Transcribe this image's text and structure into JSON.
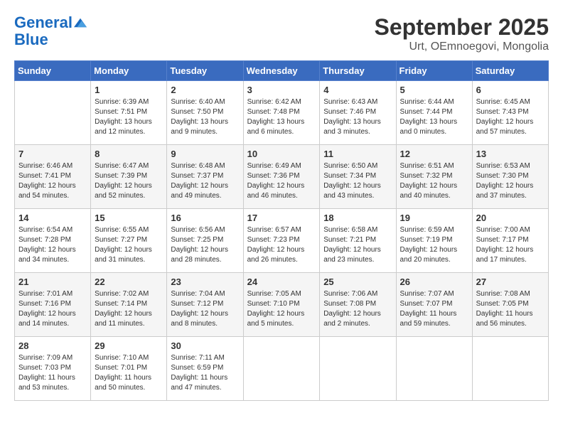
{
  "header": {
    "logo_line1": "General",
    "logo_line2": "Blue",
    "month": "September 2025",
    "location": "Urt, OEmnoegovi, Mongolia"
  },
  "weekdays": [
    "Sunday",
    "Monday",
    "Tuesday",
    "Wednesday",
    "Thursday",
    "Friday",
    "Saturday"
  ],
  "weeks": [
    [
      {
        "day": "",
        "sunrise": "",
        "sunset": "",
        "daylight": ""
      },
      {
        "day": "1",
        "sunrise": "Sunrise: 6:39 AM",
        "sunset": "Sunset: 7:51 PM",
        "daylight": "Daylight: 13 hours and 12 minutes."
      },
      {
        "day": "2",
        "sunrise": "Sunrise: 6:40 AM",
        "sunset": "Sunset: 7:50 PM",
        "daylight": "Daylight: 13 hours and 9 minutes."
      },
      {
        "day": "3",
        "sunrise": "Sunrise: 6:42 AM",
        "sunset": "Sunset: 7:48 PM",
        "daylight": "Daylight: 13 hours and 6 minutes."
      },
      {
        "day": "4",
        "sunrise": "Sunrise: 6:43 AM",
        "sunset": "Sunset: 7:46 PM",
        "daylight": "Daylight: 13 hours and 3 minutes."
      },
      {
        "day": "5",
        "sunrise": "Sunrise: 6:44 AM",
        "sunset": "Sunset: 7:44 PM",
        "daylight": "Daylight: 13 hours and 0 minutes."
      },
      {
        "day": "6",
        "sunrise": "Sunrise: 6:45 AM",
        "sunset": "Sunset: 7:43 PM",
        "daylight": "Daylight: 12 hours and 57 minutes."
      }
    ],
    [
      {
        "day": "7",
        "sunrise": "Sunrise: 6:46 AM",
        "sunset": "Sunset: 7:41 PM",
        "daylight": "Daylight: 12 hours and 54 minutes."
      },
      {
        "day": "8",
        "sunrise": "Sunrise: 6:47 AM",
        "sunset": "Sunset: 7:39 PM",
        "daylight": "Daylight: 12 hours and 52 minutes."
      },
      {
        "day": "9",
        "sunrise": "Sunrise: 6:48 AM",
        "sunset": "Sunset: 7:37 PM",
        "daylight": "Daylight: 12 hours and 49 minutes."
      },
      {
        "day": "10",
        "sunrise": "Sunrise: 6:49 AM",
        "sunset": "Sunset: 7:36 PM",
        "daylight": "Daylight: 12 hours and 46 minutes."
      },
      {
        "day": "11",
        "sunrise": "Sunrise: 6:50 AM",
        "sunset": "Sunset: 7:34 PM",
        "daylight": "Daylight: 12 hours and 43 minutes."
      },
      {
        "day": "12",
        "sunrise": "Sunrise: 6:51 AM",
        "sunset": "Sunset: 7:32 PM",
        "daylight": "Daylight: 12 hours and 40 minutes."
      },
      {
        "day": "13",
        "sunrise": "Sunrise: 6:53 AM",
        "sunset": "Sunset: 7:30 PM",
        "daylight": "Daylight: 12 hours and 37 minutes."
      }
    ],
    [
      {
        "day": "14",
        "sunrise": "Sunrise: 6:54 AM",
        "sunset": "Sunset: 7:28 PM",
        "daylight": "Daylight: 12 hours and 34 minutes."
      },
      {
        "day": "15",
        "sunrise": "Sunrise: 6:55 AM",
        "sunset": "Sunset: 7:27 PM",
        "daylight": "Daylight: 12 hours and 31 minutes."
      },
      {
        "day": "16",
        "sunrise": "Sunrise: 6:56 AM",
        "sunset": "Sunset: 7:25 PM",
        "daylight": "Daylight: 12 hours and 28 minutes."
      },
      {
        "day": "17",
        "sunrise": "Sunrise: 6:57 AM",
        "sunset": "Sunset: 7:23 PM",
        "daylight": "Daylight: 12 hours and 26 minutes."
      },
      {
        "day": "18",
        "sunrise": "Sunrise: 6:58 AM",
        "sunset": "Sunset: 7:21 PM",
        "daylight": "Daylight: 12 hours and 23 minutes."
      },
      {
        "day": "19",
        "sunrise": "Sunrise: 6:59 AM",
        "sunset": "Sunset: 7:19 PM",
        "daylight": "Daylight: 12 hours and 20 minutes."
      },
      {
        "day": "20",
        "sunrise": "Sunrise: 7:00 AM",
        "sunset": "Sunset: 7:17 PM",
        "daylight": "Daylight: 12 hours and 17 minutes."
      }
    ],
    [
      {
        "day": "21",
        "sunrise": "Sunrise: 7:01 AM",
        "sunset": "Sunset: 7:16 PM",
        "daylight": "Daylight: 12 hours and 14 minutes."
      },
      {
        "day": "22",
        "sunrise": "Sunrise: 7:02 AM",
        "sunset": "Sunset: 7:14 PM",
        "daylight": "Daylight: 12 hours and 11 minutes."
      },
      {
        "day": "23",
        "sunrise": "Sunrise: 7:04 AM",
        "sunset": "Sunset: 7:12 PM",
        "daylight": "Daylight: 12 hours and 8 minutes."
      },
      {
        "day": "24",
        "sunrise": "Sunrise: 7:05 AM",
        "sunset": "Sunset: 7:10 PM",
        "daylight": "Daylight: 12 hours and 5 minutes."
      },
      {
        "day": "25",
        "sunrise": "Sunrise: 7:06 AM",
        "sunset": "Sunset: 7:08 PM",
        "daylight": "Daylight: 12 hours and 2 minutes."
      },
      {
        "day": "26",
        "sunrise": "Sunrise: 7:07 AM",
        "sunset": "Sunset: 7:07 PM",
        "daylight": "Daylight: 11 hours and 59 minutes."
      },
      {
        "day": "27",
        "sunrise": "Sunrise: 7:08 AM",
        "sunset": "Sunset: 7:05 PM",
        "daylight": "Daylight: 11 hours and 56 minutes."
      }
    ],
    [
      {
        "day": "28",
        "sunrise": "Sunrise: 7:09 AM",
        "sunset": "Sunset: 7:03 PM",
        "daylight": "Daylight: 11 hours and 53 minutes."
      },
      {
        "day": "29",
        "sunrise": "Sunrise: 7:10 AM",
        "sunset": "Sunset: 7:01 PM",
        "daylight": "Daylight: 11 hours and 50 minutes."
      },
      {
        "day": "30",
        "sunrise": "Sunrise: 7:11 AM",
        "sunset": "Sunset: 6:59 PM",
        "daylight": "Daylight: 11 hours and 47 minutes."
      },
      {
        "day": "",
        "sunrise": "",
        "sunset": "",
        "daylight": ""
      },
      {
        "day": "",
        "sunrise": "",
        "sunset": "",
        "daylight": ""
      },
      {
        "day": "",
        "sunrise": "",
        "sunset": "",
        "daylight": ""
      },
      {
        "day": "",
        "sunrise": "",
        "sunset": "",
        "daylight": ""
      }
    ]
  ]
}
